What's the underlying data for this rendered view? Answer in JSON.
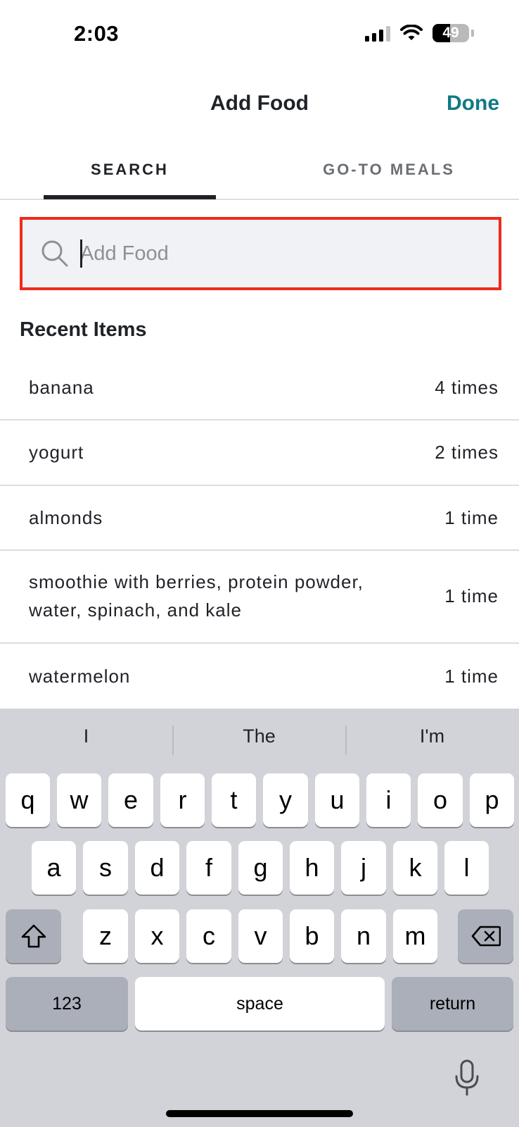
{
  "status_bar": {
    "time": "2:03",
    "battery": "49",
    "battery_level": 0.49,
    "signal_bars": 3
  },
  "header": {
    "title": "Add Food",
    "done_label": "Done"
  },
  "tabs": [
    {
      "label": "SEARCH",
      "active": true
    },
    {
      "label": "GO-TO MEALS",
      "active": false
    }
  ],
  "search": {
    "placeholder": "Add Food",
    "value": ""
  },
  "recent": {
    "title": "Recent Items",
    "items": [
      {
        "name": "banana",
        "count": "4 times"
      },
      {
        "name": "yogurt",
        "count": "2 times"
      },
      {
        "name": "almonds",
        "count": "1 time"
      },
      {
        "name": "smoothie with berries, protein powder,",
        "name_line2": "water, spinach, and kale",
        "count": "1 time"
      },
      {
        "name": "watermelon",
        "count": "1 time"
      }
    ]
  },
  "keyboard": {
    "suggestions": [
      "I",
      "The",
      "I'm"
    ],
    "row1": [
      "q",
      "w",
      "e",
      "r",
      "t",
      "y",
      "u",
      "i",
      "o",
      "p"
    ],
    "row2": [
      "a",
      "s",
      "d",
      "f",
      "g",
      "h",
      "j",
      "k",
      "l"
    ],
    "row3": [
      "z",
      "x",
      "c",
      "v",
      "b",
      "n",
      "m"
    ],
    "numbers_label": "123",
    "space_label": "space",
    "return_label": "return"
  },
  "colors": {
    "accent": "#0f7a85",
    "highlight_border": "#ee2b1e",
    "keyboard_bg": "#d1d3d9"
  }
}
